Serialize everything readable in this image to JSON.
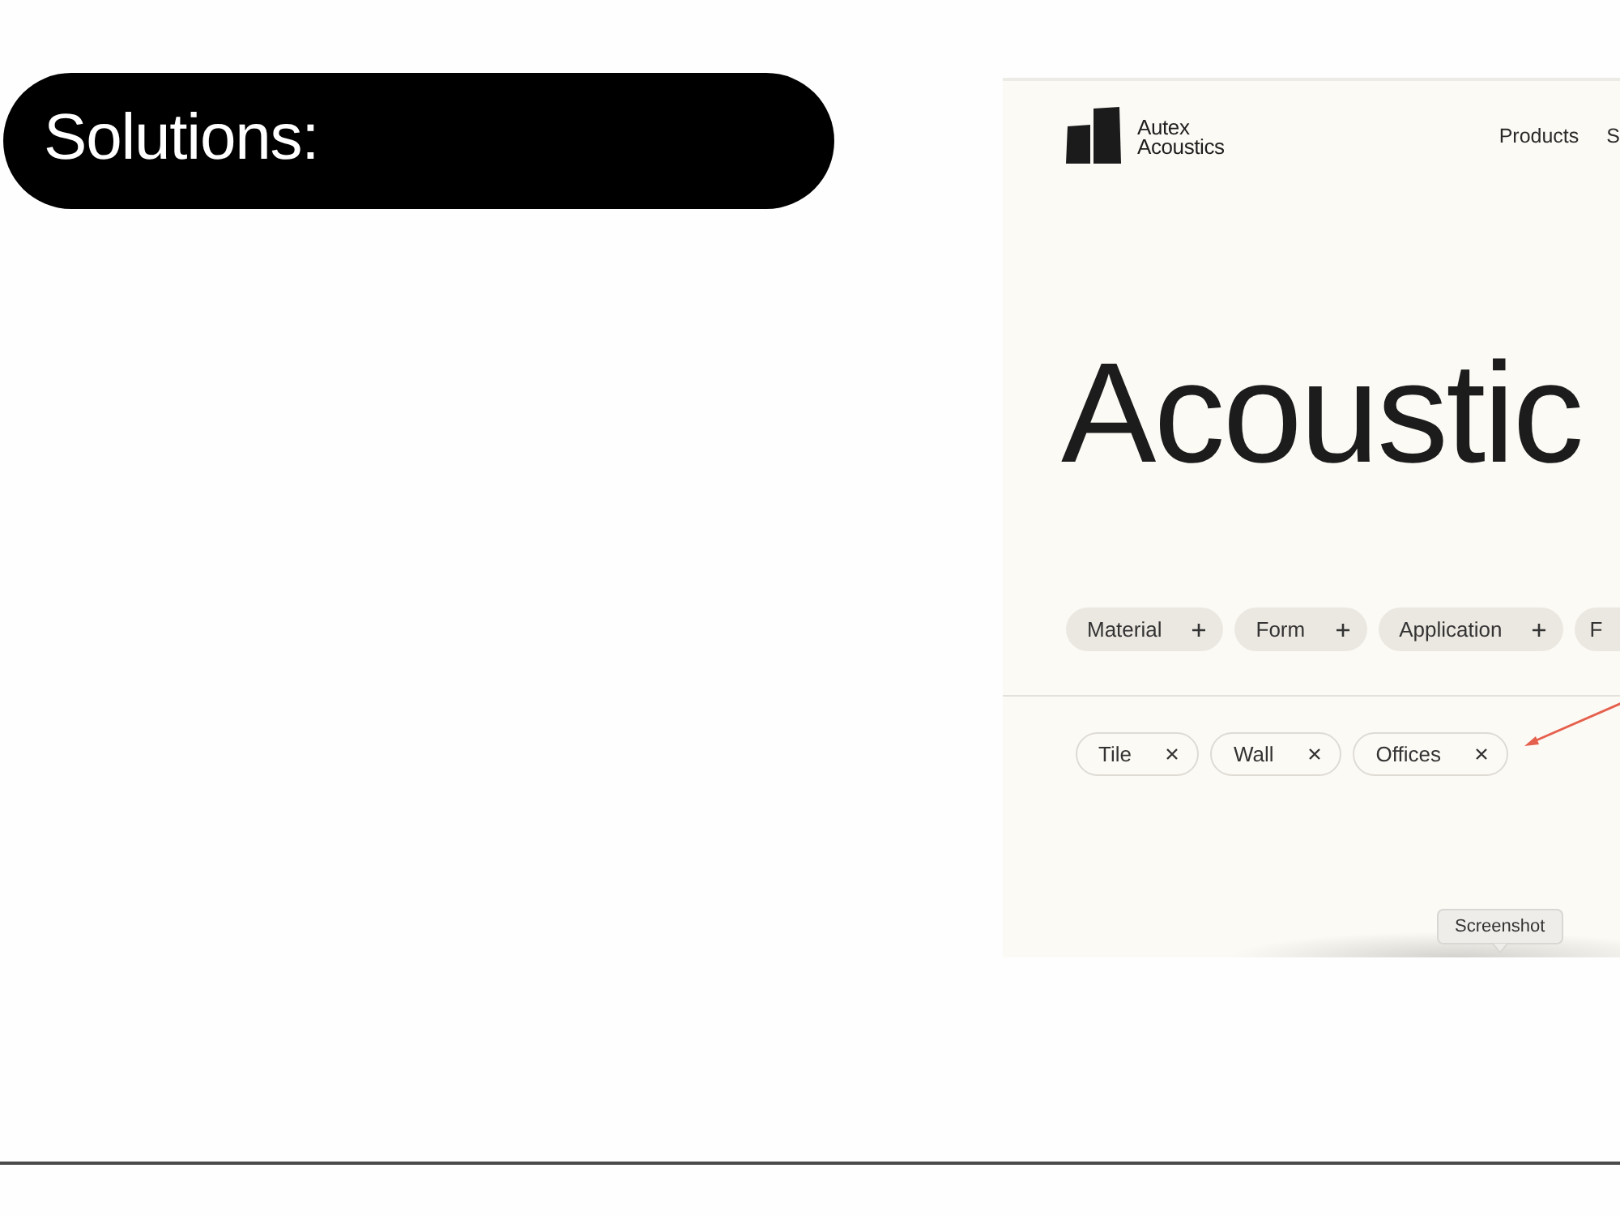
{
  "slide": {
    "title": "Solutions:"
  },
  "screenshot": {
    "brand": "Autex Acoustics",
    "nav": [
      {
        "label": "Products"
      },
      {
        "label": "S"
      }
    ],
    "headline": "Acoustic",
    "filters": [
      {
        "label": "Material"
      },
      {
        "label": "Form"
      },
      {
        "label": "Application"
      },
      {
        "label": "F"
      }
    ],
    "applied_filters": [
      {
        "label": "Tile"
      },
      {
        "label": "Wall"
      },
      {
        "label": "Offices"
      }
    ],
    "tooltip": "Screenshot"
  }
}
